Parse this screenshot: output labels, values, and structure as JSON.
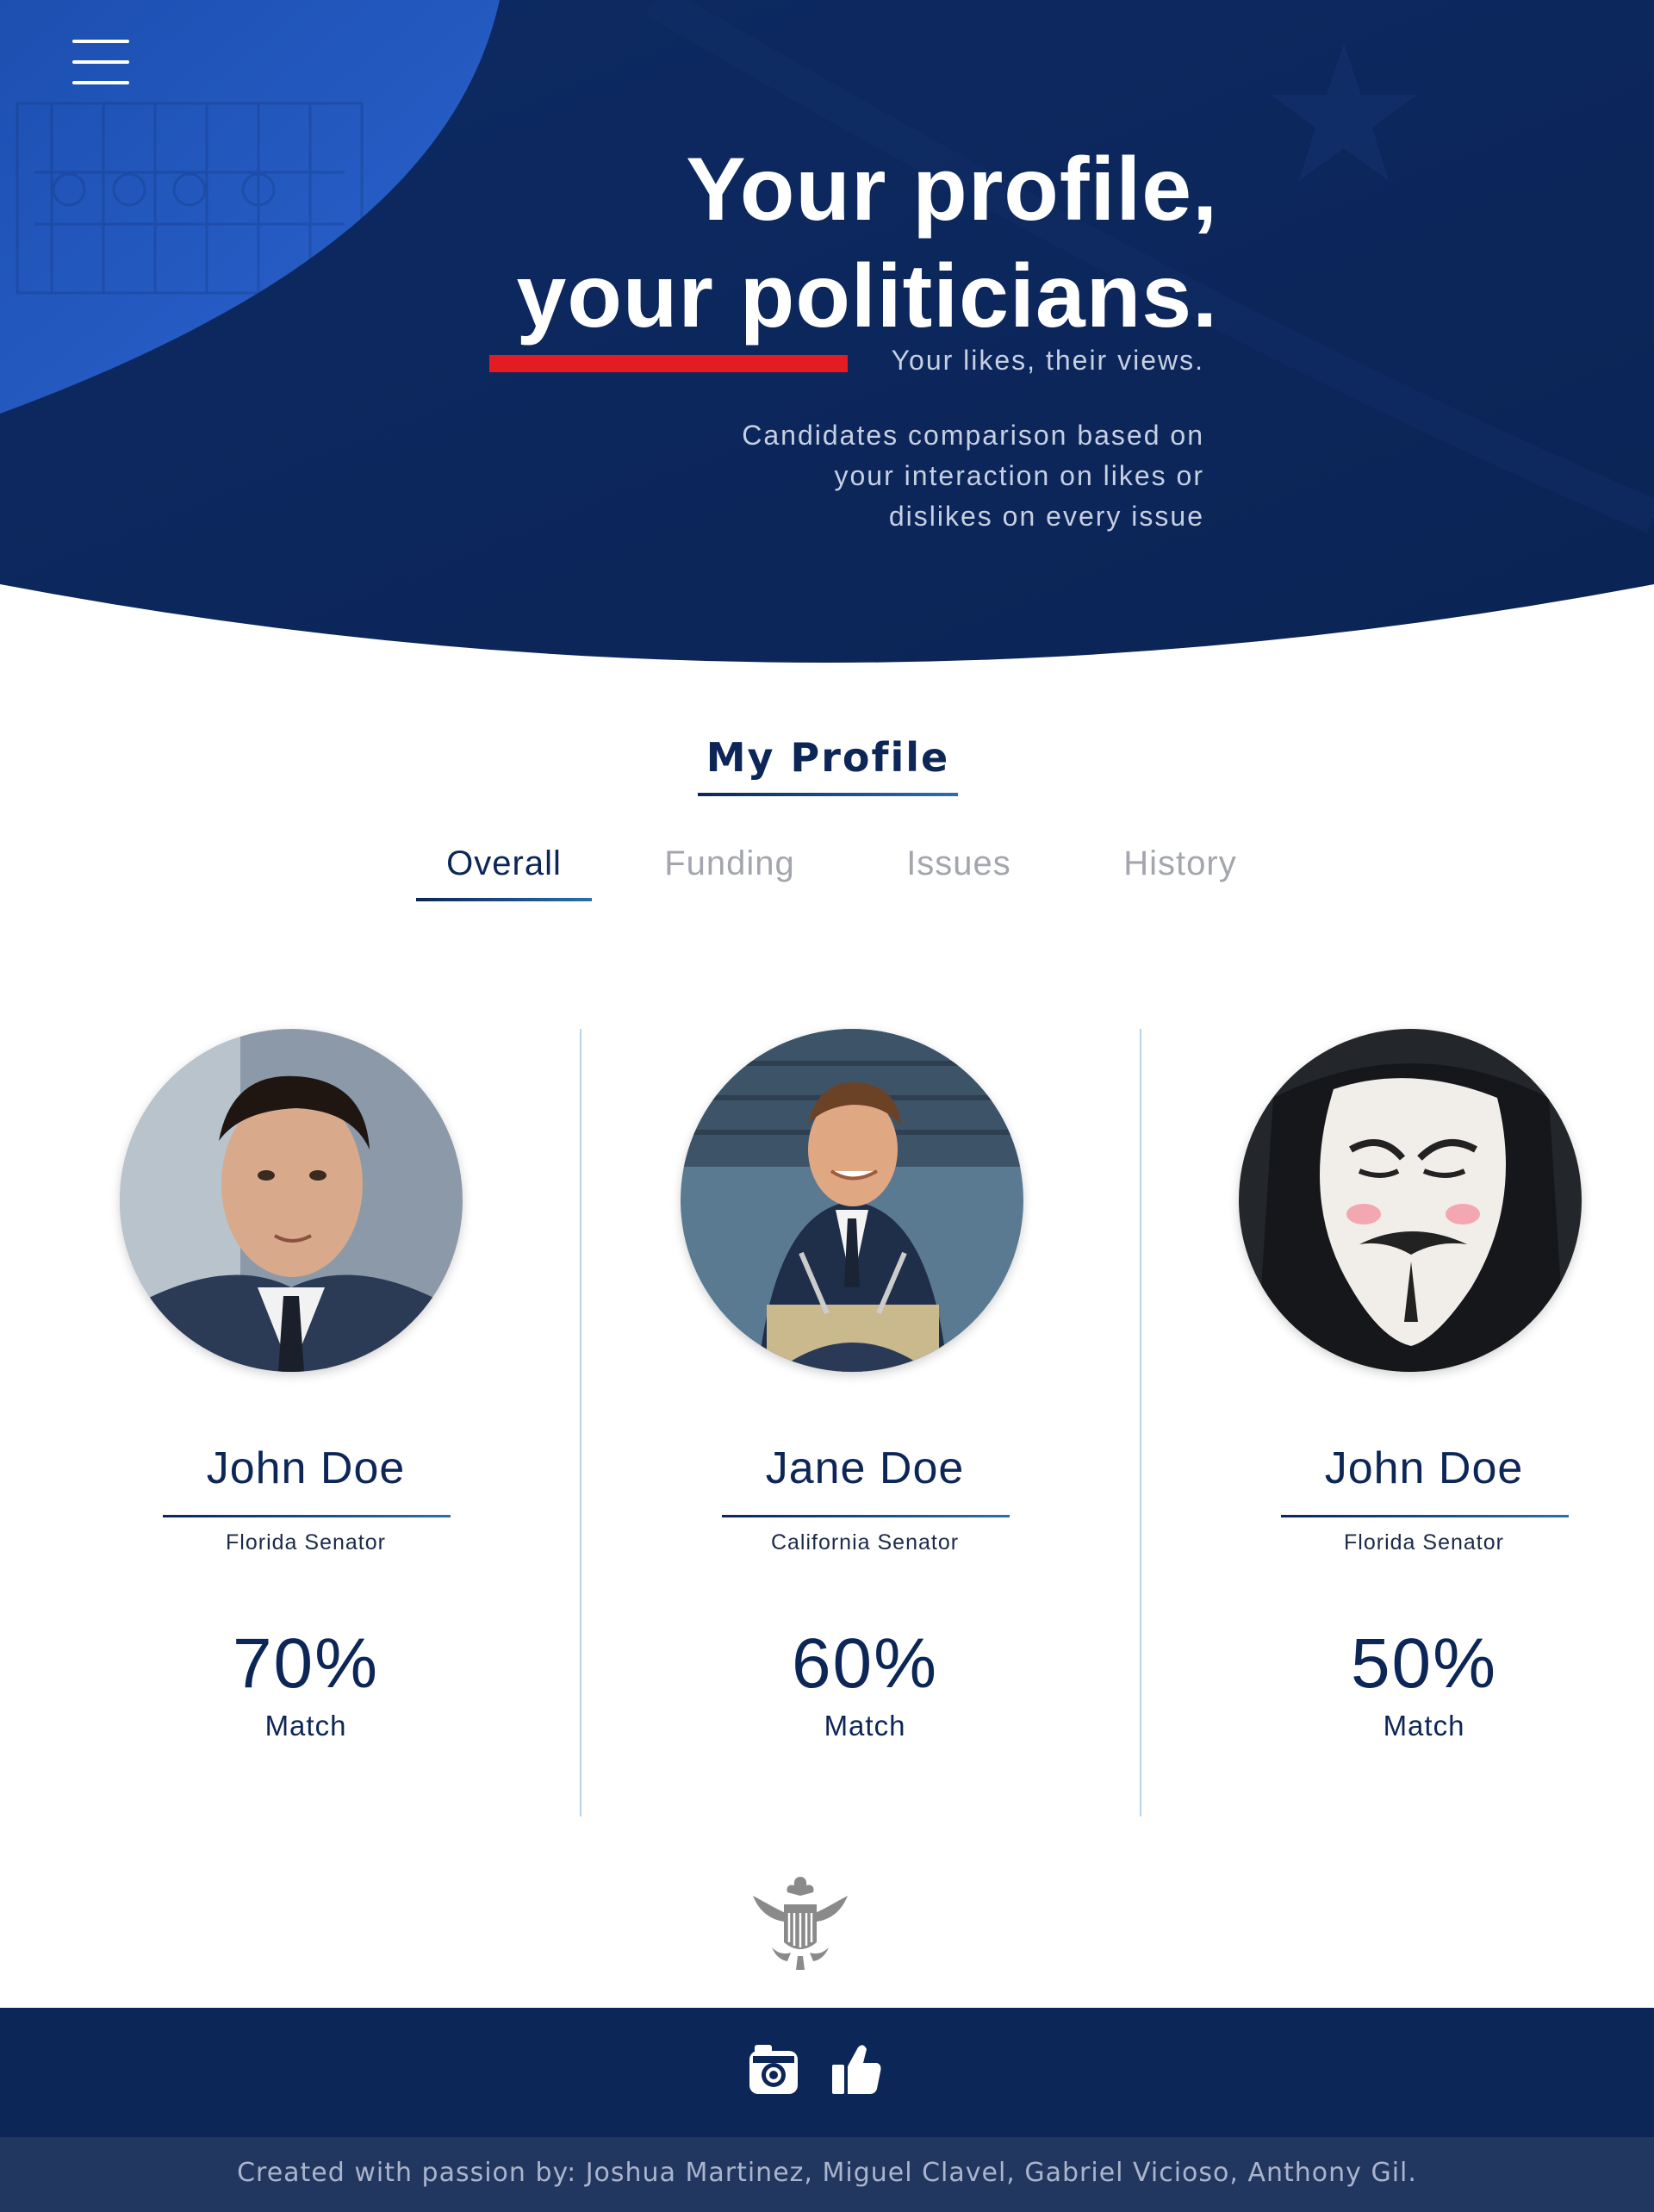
{
  "hero": {
    "menu_icon": "hamburger-menu-icon",
    "title_line1": "Your profile,",
    "title_line2": "your politicians.",
    "tagline": "Your likes, their views.",
    "description_lines": [
      "Candidates comparison based on",
      "your interaction on likes or",
      "dislikes on every issue"
    ]
  },
  "profile": {
    "title": "My Profile",
    "tabs": [
      {
        "label": "Overall",
        "active": true
      },
      {
        "label": "Funding",
        "active": false
      },
      {
        "label": "Issues",
        "active": false
      },
      {
        "label": "History",
        "active": false
      }
    ]
  },
  "candidates": [
    {
      "name": "John Doe",
      "role": "Florida Senator",
      "percent": "70%",
      "match_label": "Match",
      "photo": "man-in-suit-portrait"
    },
    {
      "name": "Jane Doe",
      "role": "California Senator",
      "percent": "60%",
      "match_label": "Match",
      "photo": "speaker-at-podium-portrait"
    },
    {
      "name": "John Doe",
      "role": "Florida Senator",
      "percent": "50%",
      "match_label": "Match",
      "photo": "guy-fawkes-mask-portrait"
    }
  ],
  "footer": {
    "icons": [
      "camera-icon",
      "thumbs-up-icon"
    ],
    "credits": "Created with passion by: Joshua Martinez, Miguel Clavel, Gabriel Vicioso, Anthony Gil."
  },
  "colors": {
    "navy": "#0c2657",
    "accent_red": "#e31b23",
    "footer_bottom": "#22375f",
    "divider": "#b9d3e6"
  }
}
